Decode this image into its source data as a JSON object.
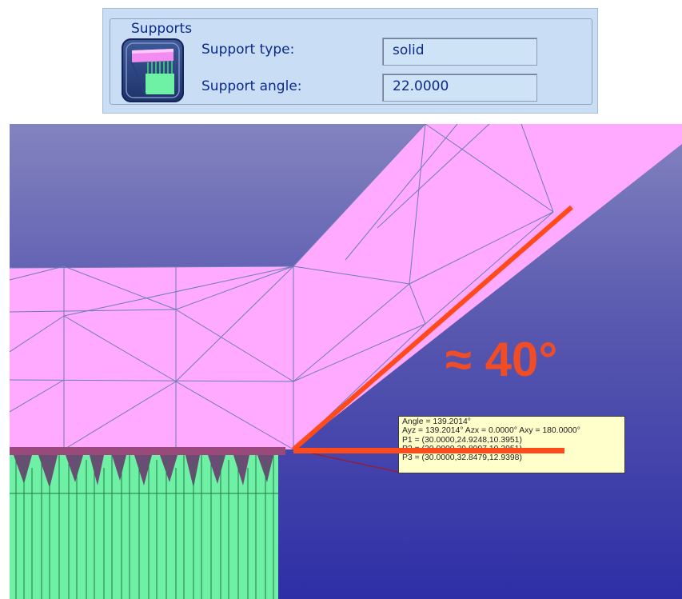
{
  "supports": {
    "title": "Supports",
    "type_label": "Support type:",
    "type_value": "solid",
    "angle_label": "Support angle:",
    "angle_value": "22.0000"
  },
  "annotation": {
    "angle_text": "≈ 40°"
  },
  "measurement": {
    "lines": [
      "Angle = 139.2014°",
      "Ayz = 139.2014° Azx = 0.0000° Axy = 180.0000°",
      "P1 = (30.0000,24.9248,10.3951)",
      "P2 = (30.0000,29.8997,10.3951)",
      "P3 = (30.0000,32.8479,12.9398)"
    ]
  },
  "colors": {
    "mesh_fill": "#ffaaff",
    "support_fill": "#6ef0a5",
    "annotation": "#f04c26",
    "panel_bg": "#c9def4"
  }
}
